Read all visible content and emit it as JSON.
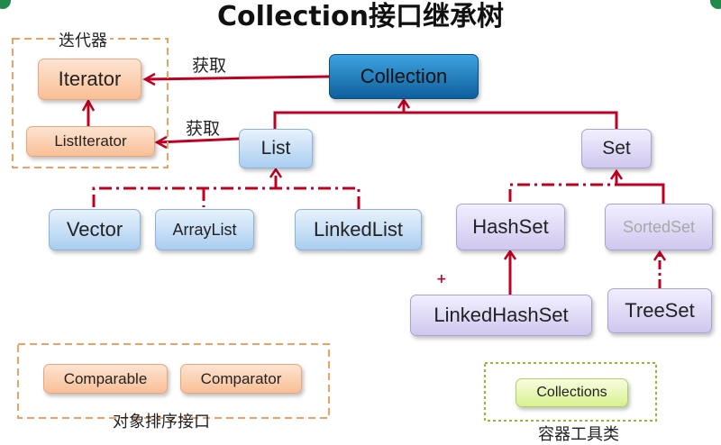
{
  "title": "Collection接口继承树",
  "labels": {
    "iterator_group": "迭代器",
    "get_1": "获取",
    "get_2": "获取",
    "compare_group": "对象排序接口",
    "tools_group": "容器工具类",
    "plus": "+"
  },
  "nodes": {
    "collection": "Collection",
    "iterator": "Iterator",
    "list_iterator": "ListIterator",
    "list": "List",
    "set": "Set",
    "vector": "Vector",
    "array_list": "ArrayList",
    "linked_list": "LinkedList",
    "hash_set": "HashSet",
    "sorted_set": "SortedSet",
    "linked_hash_set": "LinkedHashSet",
    "tree_set": "TreeSet",
    "comparable": "Comparable",
    "comparator": "Comparator",
    "collections": "Collections"
  },
  "colors": {
    "connector": "#c00020",
    "group_border_orange": "#f0a060",
    "group_border_green": "#98b830"
  }
}
